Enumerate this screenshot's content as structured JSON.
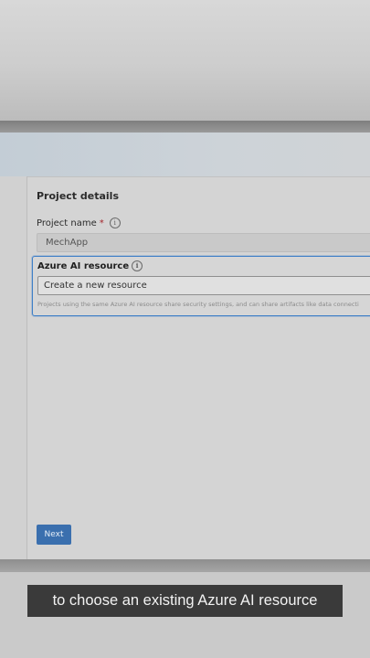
{
  "form": {
    "section_title": "Project details",
    "project_name": {
      "label": "Project name",
      "required_marker": "*",
      "info_icon": "info-icon",
      "value": "MechApp"
    },
    "azure_resource": {
      "label": "Azure AI resource",
      "info_icon": "info-icon",
      "value": "Create a new resource",
      "help_text": "Projects using the same Azure AI resource share security settings, and can share artifacts like data connecti"
    },
    "next_label": "Next"
  },
  "caption": {
    "text": "to choose an existing Azure AI resource"
  },
  "colors": {
    "primary_button": "#3a6fae",
    "focus_border": "#3e7fc7",
    "caption_bg": "#3a3a3a"
  }
}
